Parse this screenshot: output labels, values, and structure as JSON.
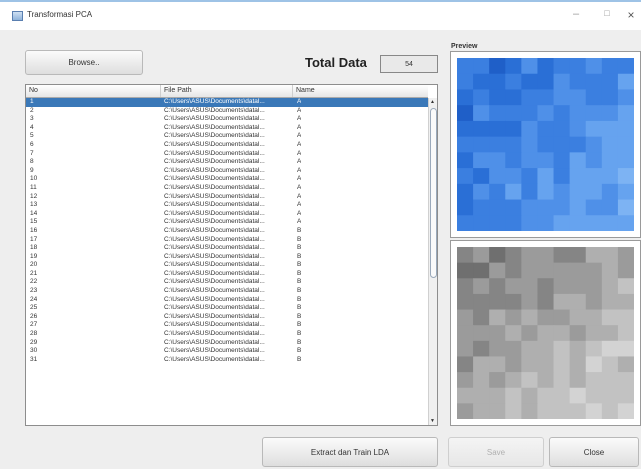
{
  "window": {
    "title": "Transformasi PCA",
    "controls": {
      "minimize": "–",
      "maximize": "□",
      "close": "×"
    }
  },
  "toolbar": {
    "browse_label": "Browse..",
    "total_label": "Total Data",
    "total_value": "54"
  },
  "table": {
    "columns": [
      "No",
      "File Path",
      "Name"
    ],
    "selected_index": 0,
    "rows": [
      {
        "no": "1",
        "path": "C:\\Users\\ASUS\\Documents\\datal...",
        "name": "A"
      },
      {
        "no": "2",
        "path": "C:\\Users\\ASUS\\Documents\\datal...",
        "name": "A"
      },
      {
        "no": "3",
        "path": "C:\\Users\\ASUS\\Documents\\datal...",
        "name": "A"
      },
      {
        "no": "4",
        "path": "C:\\Users\\ASUS\\Documents\\datal...",
        "name": "A"
      },
      {
        "no": "5",
        "path": "C:\\Users\\ASUS\\Documents\\datal...",
        "name": "A"
      },
      {
        "no": "6",
        "path": "C:\\Users\\ASUS\\Documents\\datal...",
        "name": "A"
      },
      {
        "no": "7",
        "path": "C:\\Users\\ASUS\\Documents\\datal...",
        "name": "A"
      },
      {
        "no": "8",
        "path": "C:\\Users\\ASUS\\Documents\\datal...",
        "name": "A"
      },
      {
        "no": "9",
        "path": "C:\\Users\\ASUS\\Documents\\datal...",
        "name": "A"
      },
      {
        "no": "10",
        "path": "C:\\Users\\ASUS\\Documents\\datal...",
        "name": "A"
      },
      {
        "no": "11",
        "path": "C:\\Users\\ASUS\\Documents\\datal...",
        "name": "A"
      },
      {
        "no": "12",
        "path": "C:\\Users\\ASUS\\Documents\\datal...",
        "name": "A"
      },
      {
        "no": "13",
        "path": "C:\\Users\\ASUS\\Documents\\datal...",
        "name": "A"
      },
      {
        "no": "14",
        "path": "C:\\Users\\ASUS\\Documents\\datal...",
        "name": "A"
      },
      {
        "no": "15",
        "path": "C:\\Users\\ASUS\\Documents\\datal...",
        "name": "A"
      },
      {
        "no": "16",
        "path": "C:\\Users\\ASUS\\Documents\\datal...",
        "name": "B"
      },
      {
        "no": "17",
        "path": "C:\\Users\\ASUS\\Documents\\datal...",
        "name": "B"
      },
      {
        "no": "18",
        "path": "C:\\Users\\ASUS\\Documents\\datal...",
        "name": "B"
      },
      {
        "no": "19",
        "path": "C:\\Users\\ASUS\\Documents\\datal...",
        "name": "B"
      },
      {
        "no": "20",
        "path": "C:\\Users\\ASUS\\Documents\\datal...",
        "name": "B"
      },
      {
        "no": "21",
        "path": "C:\\Users\\ASUS\\Documents\\datal...",
        "name": "B"
      },
      {
        "no": "22",
        "path": "C:\\Users\\ASUS\\Documents\\datal...",
        "name": "B"
      },
      {
        "no": "23",
        "path": "C:\\Users\\ASUS\\Documents\\datal...",
        "name": "B"
      },
      {
        "no": "24",
        "path": "C:\\Users\\ASUS\\Documents\\datal...",
        "name": "B"
      },
      {
        "no": "25",
        "path": "C:\\Users\\ASUS\\Documents\\datal...",
        "name": "B"
      },
      {
        "no": "26",
        "path": "C:\\Users\\ASUS\\Documents\\datal...",
        "name": "B"
      },
      {
        "no": "27",
        "path": "C:\\Users\\ASUS\\Documents\\datal...",
        "name": "B"
      },
      {
        "no": "28",
        "path": "C:\\Users\\ASUS\\Documents\\datal...",
        "name": "B"
      },
      {
        "no": "29",
        "path": "C:\\Users\\ASUS\\Documents\\datal...",
        "name": "B"
      },
      {
        "no": "30",
        "path": "C:\\Users\\ASUS\\Documents\\datal...",
        "name": "B"
      },
      {
        "no": "31",
        "path": "C:\\Users\\ASUS\\Documents\\datal...",
        "name": "B"
      }
    ]
  },
  "preview": {
    "label": "Preview",
    "original_palette": [
      "#1f5fc8",
      "#2a6fd6",
      "#3b7fe0",
      "#4f90e8",
      "#66a3ef",
      "#7db3f3"
    ],
    "processed_palette": [
      "#6f6f6f",
      "#858585",
      "#9b9b9b",
      "#afafaf",
      "#c2c2c2",
      "#d3d3d3"
    ]
  },
  "actions": {
    "extract_label": "Extract dan Train LDA",
    "save_label": "Save",
    "close_label": "Close"
  }
}
